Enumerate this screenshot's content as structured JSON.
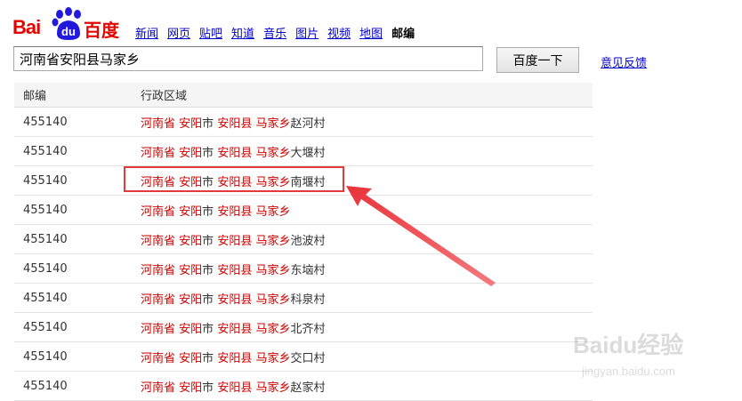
{
  "logo": {
    "bai": "Bai",
    "du": "du",
    "baidu_cn": "百度"
  },
  "nav": [
    "新闻",
    "网页",
    "贴吧",
    "知道",
    "音乐",
    "图片",
    "视频",
    "地图"
  ],
  "nav_current": "邮编",
  "search": {
    "query": "河南省安阳县马家乡"
  },
  "search_button": "百度一下",
  "feedback_link": "意见反馈",
  "table": {
    "headers": {
      "zip": "邮编",
      "region": "行政区域"
    },
    "rows": [
      {
        "zip": "455140",
        "province": "河南省",
        "city": "安阳",
        "city_suffix": "市",
        "county": "安阳县",
        "town": "马家乡",
        "village": "赵河村"
      },
      {
        "zip": "455140",
        "province": "河南省",
        "city": "安阳",
        "city_suffix": "市",
        "county": "安阳县",
        "town": "马家乡",
        "village": "大堰村"
      },
      {
        "zip": "455140",
        "province": "河南省",
        "city": "安阳",
        "city_suffix": "市",
        "county": "安阳县",
        "town": "马家乡",
        "village": "南堰村"
      },
      {
        "zip": "455140",
        "province": "河南省",
        "city": "安阳",
        "city_suffix": "市",
        "county": "安阳县",
        "town": "马家乡",
        "village": ""
      },
      {
        "zip": "455140",
        "province": "河南省",
        "city": "安阳",
        "city_suffix": "市",
        "county": "安阳县",
        "town": "马家乡",
        "village": "池波村"
      },
      {
        "zip": "455140",
        "province": "河南省",
        "city": "安阳",
        "city_suffix": "市",
        "county": "安阳县",
        "town": "马家乡",
        "village": "东垴村"
      },
      {
        "zip": "455140",
        "province": "河南省",
        "city": "安阳",
        "city_suffix": "市",
        "county": "安阳县",
        "town": "马家乡",
        "village": "科泉村"
      },
      {
        "zip": "455140",
        "province": "河南省",
        "city": "安阳",
        "city_suffix": "市",
        "county": "安阳县",
        "town": "马家乡",
        "village": "北齐村"
      },
      {
        "zip": "455140",
        "province": "河南省",
        "city": "安阳",
        "city_suffix": "市",
        "county": "安阳县",
        "town": "马家乡",
        "village": "交口村"
      },
      {
        "zip": "455140",
        "province": "河南省",
        "city": "安阳",
        "city_suffix": "市",
        "county": "安阳县",
        "town": "马家乡",
        "village": "赵家村"
      }
    ]
  },
  "watermark": {
    "brand": "Baidu经验",
    "site": "jingyan.baidu.com"
  },
  "colors": {
    "link_red": "#cc0000",
    "link_blue": "#0000cc",
    "annotation_red": "#e33b3b",
    "brand_red": "#e10602"
  }
}
